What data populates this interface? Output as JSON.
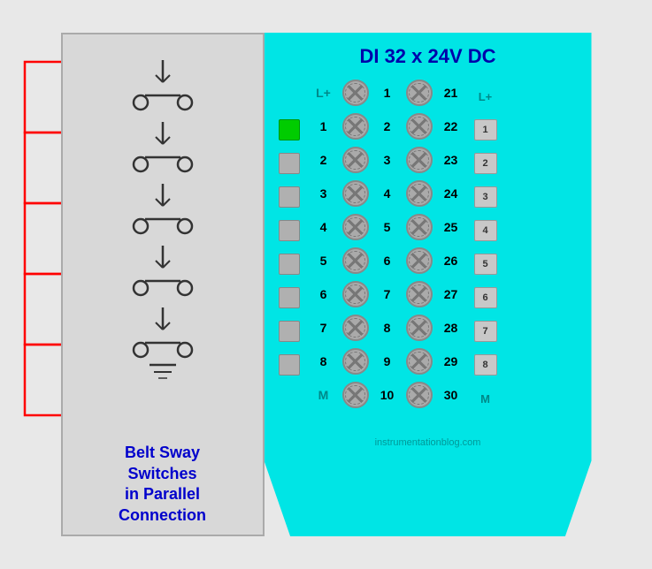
{
  "title": "DI 32 x 24V DC",
  "label": {
    "line1": "Belt Sway",
    "line2": "Switches",
    "line3": "in Parallel",
    "line4": "Connection"
  },
  "left_header": "L+",
  "right_header": "L+",
  "watermark": "instrumentationblog.com",
  "rows": [
    {
      "left_num": "L+",
      "left_screw": "1",
      "right_screw": "21",
      "right_num": "L+",
      "indicator": "spacer",
      "right_box": "spacer",
      "left_cyan": true,
      "right_cyan": true
    },
    {
      "left_num": "1",
      "left_screw": "2",
      "right_screw": "22",
      "right_num": "1",
      "indicator": "active",
      "right_box": "box"
    },
    {
      "left_num": "2",
      "left_screw": "3",
      "right_screw": "23",
      "right_num": "2",
      "indicator": "box",
      "right_box": "box"
    },
    {
      "left_num": "3",
      "left_screw": "4",
      "right_screw": "24",
      "right_num": "3",
      "indicator": "box",
      "right_box": "box"
    },
    {
      "left_num": "4",
      "left_screw": "5",
      "right_screw": "25",
      "right_num": "4",
      "indicator": "box",
      "right_box": "box"
    },
    {
      "left_num": "5",
      "left_screw": "6",
      "right_screw": "26",
      "right_num": "5",
      "indicator": "box",
      "right_box": "box"
    },
    {
      "left_num": "6",
      "left_screw": "7",
      "right_screw": "27",
      "right_num": "6",
      "indicator": "box",
      "right_box": "box"
    },
    {
      "left_num": "7",
      "left_screw": "8",
      "right_screw": "28",
      "right_num": "7",
      "indicator": "box",
      "right_box": "box"
    },
    {
      "left_num": "8",
      "left_screw": "9",
      "right_screw": "29",
      "right_num": "8",
      "indicator": "box",
      "right_box": "box"
    },
    {
      "left_num": "M",
      "left_screw": "10",
      "right_screw": "30",
      "right_num": "M",
      "indicator": "spacer",
      "right_box": "spacer",
      "left_cyan": true,
      "right_cyan": true
    }
  ]
}
